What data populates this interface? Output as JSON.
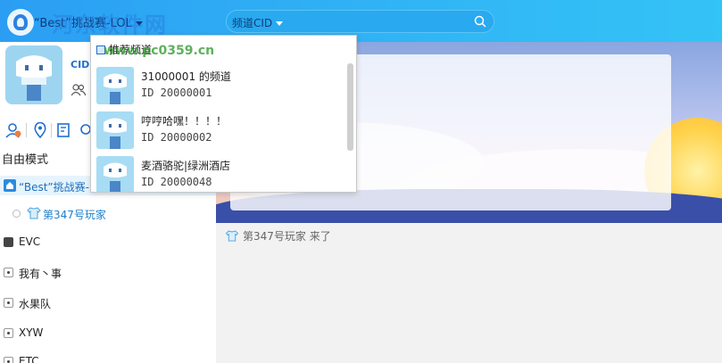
{
  "header": {
    "channel_name": "“Best”挑战赛-LOL",
    "watermark": "河东软件网",
    "watermark_url": "www.pc0359.cn",
    "search_label": "频道CID"
  },
  "profile": {
    "badge": "CID"
  },
  "sidebar": {
    "mode_label": "自由模式",
    "current_channel": "“Best”挑战赛-LOL",
    "current_user": "第347号玩家",
    "subchannels": [
      {
        "label": "EVC",
        "locked": true
      },
      {
        "label": "我有丶事",
        "locked": false
      },
      {
        "label": "水果队",
        "locked": false
      },
      {
        "label": "XYW",
        "locked": false
      },
      {
        "label": "ETC",
        "locked": false
      }
    ]
  },
  "dropdown": {
    "header": "推荐频道",
    "items": [
      {
        "name": "31000001 的频道",
        "id": "ID 20000001"
      },
      {
        "name": "哼哼哈嘿！！！！",
        "id": "ID 20000002"
      },
      {
        "name": "麦酒骆驼|绿洲酒店",
        "id": "ID 20000048"
      }
    ]
  },
  "main": {
    "join_message": "第347号玩家 来了"
  },
  "colors": {
    "topbar": "#2b9ef3",
    "accent": "#1d6fbf",
    "selected_row": "#e6f4fd"
  }
}
